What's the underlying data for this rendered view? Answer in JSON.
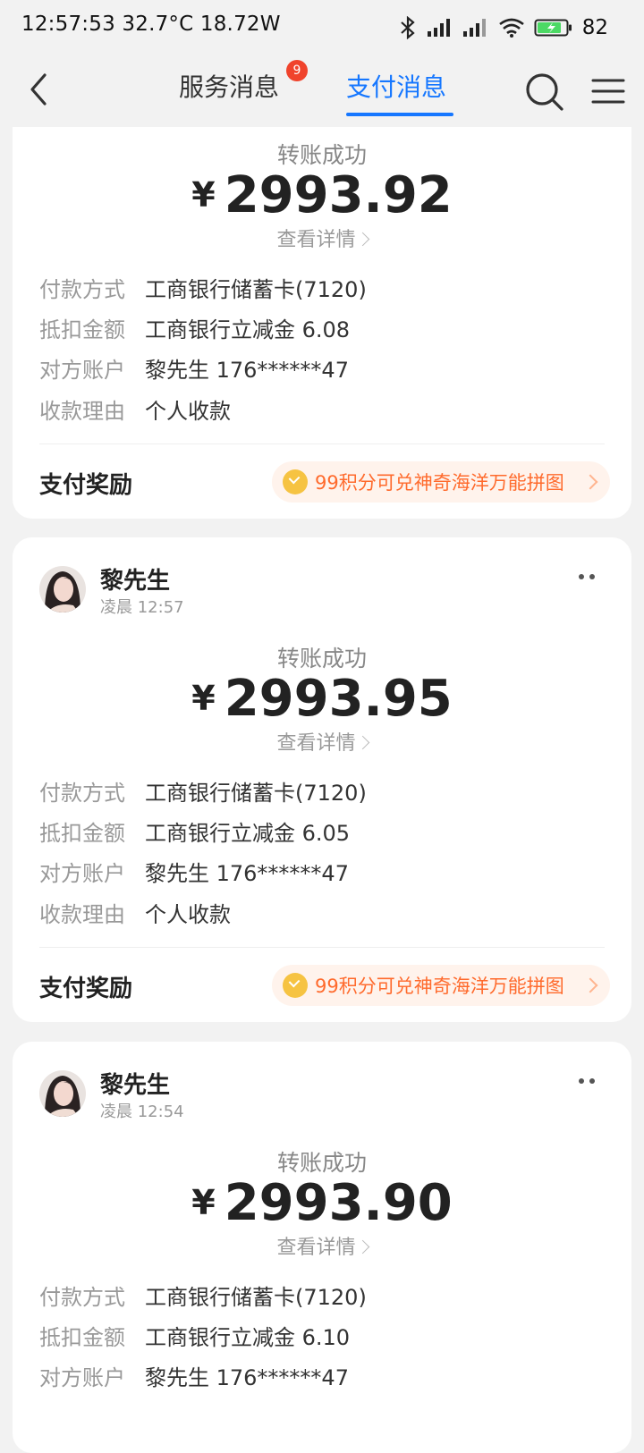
{
  "status_bar": {
    "text": "12:57:53 32.7°C  18.72W",
    "battery": "82"
  },
  "nav": {
    "tabs": [
      {
        "label": "服务消息",
        "badge": "9"
      },
      {
        "label": "支付消息"
      }
    ],
    "active_color": "#1677ff"
  },
  "cards": [
    {
      "status": "转账成功",
      "currency": "¥",
      "amount": "2993.92",
      "detail_link": "查看详情",
      "rows": [
        {
          "k": "付款方式",
          "v": "工商银行储蓄卡(7120)"
        },
        {
          "k": "抵扣金额",
          "v": "工商银行立减金 6.08"
        },
        {
          "k": "对方账户",
          "v": "黎先生 176******47"
        },
        {
          "k": "收款理由",
          "v": "个人收款"
        }
      ],
      "reward_title": "支付奖励",
      "reward_text": "99积分可兑神奇海洋万能拼图"
    },
    {
      "sender": "黎先生",
      "time": "凌晨 12:57",
      "status": "转账成功",
      "currency": "¥",
      "amount": "2993.95",
      "detail_link": "查看详情",
      "rows": [
        {
          "k": "付款方式",
          "v": "工商银行储蓄卡(7120)"
        },
        {
          "k": "抵扣金额",
          "v": "工商银行立减金 6.05"
        },
        {
          "k": "对方账户",
          "v": "黎先生 176******47"
        },
        {
          "k": "收款理由",
          "v": "个人收款"
        }
      ],
      "reward_title": "支付奖励",
      "reward_text": "99积分可兑神奇海洋万能拼图"
    },
    {
      "sender": "黎先生",
      "time": "凌晨 12:54",
      "status": "转账成功",
      "currency": "¥",
      "amount": "2993.90",
      "detail_link": "查看详情",
      "rows": [
        {
          "k": "付款方式",
          "v": "工商银行储蓄卡(7120)"
        },
        {
          "k": "抵扣金额",
          "v": "工商银行立减金 6.10"
        },
        {
          "k": "对方账户",
          "v": "黎先生 176******47"
        }
      ]
    }
  ]
}
